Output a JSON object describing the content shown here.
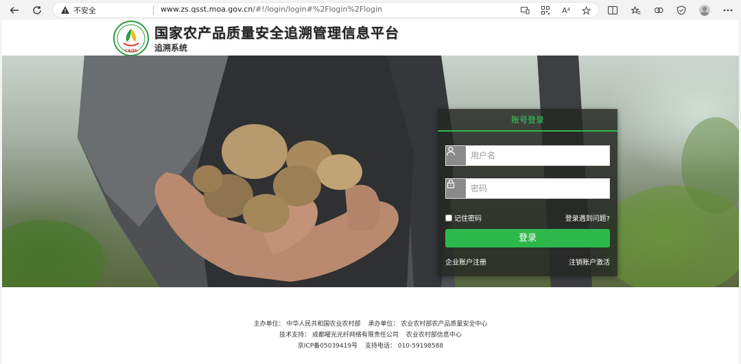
{
  "browser": {
    "insecure_label": "不安全",
    "url_host": "www.zs.qsst.moa.gov.cn",
    "url_rest": "/#!/login/login#%2Flogin%2Flogin",
    "read_aloud": "A⁴"
  },
  "header": {
    "title": "国家农产品质量安全追溯管理信息平台",
    "subtitle": "追溯系统",
    "logo_text": "CAQS"
  },
  "login": {
    "tab_label": "账号登录",
    "username_placeholder": "用户名",
    "password_placeholder": "密码",
    "remember_label": "记住密码",
    "problem_link": "登录遇到问题?",
    "submit_label": "登录",
    "register_link": "企业账户注册",
    "activate_link": "注销账户激活"
  },
  "footer": {
    "sponsor_label": "主办单位：",
    "sponsor": "中华人民共和国农业农村部",
    "organizer_label": "承办单位：",
    "organizer": "农业农村部农产品质量安全中心",
    "tech_label": "技术支持：",
    "tech1": "成都曜光光纤网络有限责任公司",
    "tech2": "农业农村部信息中心",
    "icp": "京ICP备05039419号",
    "phone_label": "支持电话：",
    "phone": "010-59198588"
  },
  "colors": {
    "accent_green": "#2db84c",
    "tab_green": "#2fd157"
  }
}
